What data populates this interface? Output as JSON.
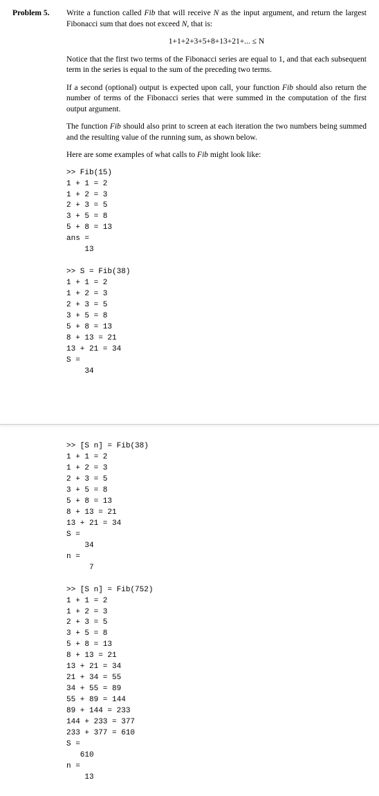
{
  "label": "Problem 5.",
  "p1": "Write a function called Fib that will receive N as the input argument, and return the largest Fibonacci sum that does not exceed N, that is:",
  "formula": "1+1+2+3+5+8+13+21+... ≤ N",
  "p2": "Notice that the first two terms of the Fibonacci series are equal to 1, and that each subsequent term in the series is equal to the sum of the preceding two terms.",
  "p3": "If a second (optional) output is expected upon call, your function Fib should also return the number of terms of the Fibonacci series that were summed in the computation of the first output argument.",
  "p4": "The function Fib should also print to screen at each iteration the two numbers being summed and the resulting value of the running sum, as shown below.",
  "p5": "Here are some examples of what calls to Fib might look like:",
  "code1": ">> Fib(15)\n1 + 1 = 2\n1 + 2 = 3\n2 + 3 = 5\n3 + 5 = 8\n5 + 8 = 13\nans =\n    13\n\n>> S = Fib(38)\n1 + 1 = 2\n1 + 2 = 3\n2 + 3 = 5\n3 + 5 = 8\n5 + 8 = 13\n8 + 13 = 21\n13 + 21 = 34\nS =\n    34",
  "code2": ">> [S n] = Fib(38)\n1 + 1 = 2\n1 + 2 = 3\n2 + 3 = 5\n3 + 5 = 8\n5 + 8 = 13\n8 + 13 = 21\n13 + 21 = 34\nS =\n    34\nn =\n     7\n\n>> [S n] = Fib(752)\n1 + 1 = 2\n1 + 2 = 3\n2 + 3 = 5\n3 + 5 = 8\n5 + 8 = 13\n8 + 13 = 21\n13 + 21 = 34\n21 + 34 = 55\n34 + 55 = 89\n55 + 89 = 144\n89 + 144 = 233\n144 + 233 = 377\n233 + 377 = 610\nS =\n   610\nn =\n    13"
}
